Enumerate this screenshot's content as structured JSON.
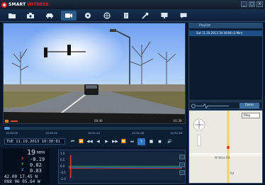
{
  "app": {
    "brand_part1": "SMART",
    "brand_part2": "WITNESS"
  },
  "window_controls": [
    "_",
    "□",
    "×"
  ],
  "toolbar": [
    {
      "icon": "folder-icon"
    },
    {
      "icon": "camera-icon"
    },
    {
      "icon": "car-icon"
    },
    {
      "icon": "video-camera-icon",
      "active": true
    },
    {
      "icon": "settings-wheel-icon"
    },
    {
      "icon": "globe-icon"
    },
    {
      "icon": "document-icon"
    },
    {
      "icon": "wrench-icon"
    },
    {
      "icon": "monitor-icon"
    },
    {
      "icon": "chat-icon"
    }
  ],
  "video": {
    "bottom_left": "",
    "bottom_center": "00:49",
    "bottom_right": "01:39"
  },
  "playlist": {
    "header": "Playlist",
    "items": [
      "Sat 11.19.2013 10:30:06 (3 Min)"
    ]
  },
  "gsensor": {
    "done_label": "Done"
  },
  "map": {
    "select_value": "Map",
    "street_label": "W Wise Rd",
    "side_label": "Rd"
  },
  "timeline": {
    "progress_pct": 3,
    "ticks": [
      "10:30:00",
      "10:30:42",
      "10:31:24",
      "10:32:06",
      "10:32:48"
    ]
  },
  "datetime": "TUE 11.19.2013 10:30:01",
  "playback": [
    "⏮",
    "⏪",
    "◀◀",
    "◀",
    "▶",
    "▶▶",
    "⏩",
    "⏭",
    "1",
    "■",
    "◼",
    "🔊"
  ],
  "readout": {
    "speed": "19",
    "speed_unit": "MPH",
    "x_label": "X",
    "x_value": "-0.19",
    "y_label": "Y",
    "y_value": "0.02",
    "z_label": "Z",
    "z_value": "0.03",
    "lat": "42.00 17.45 N",
    "lon": "088 06 05.64 W"
  },
  "graph": {
    "y_ticks": [
      "1.0",
      "0.5",
      "0.0",
      "-0.5",
      "-1.0"
    ],
    "x_ticks": [
      "10:30:00",
      "10:30:42",
      "10:31:24",
      "10:32:06"
    ]
  },
  "colors": {
    "accent": "#2a74c2",
    "bg": "#0a1627",
    "x_axis": "#d83a3a",
    "y_axis": "#3ac06a",
    "z_axis": "#3a8ee0"
  }
}
